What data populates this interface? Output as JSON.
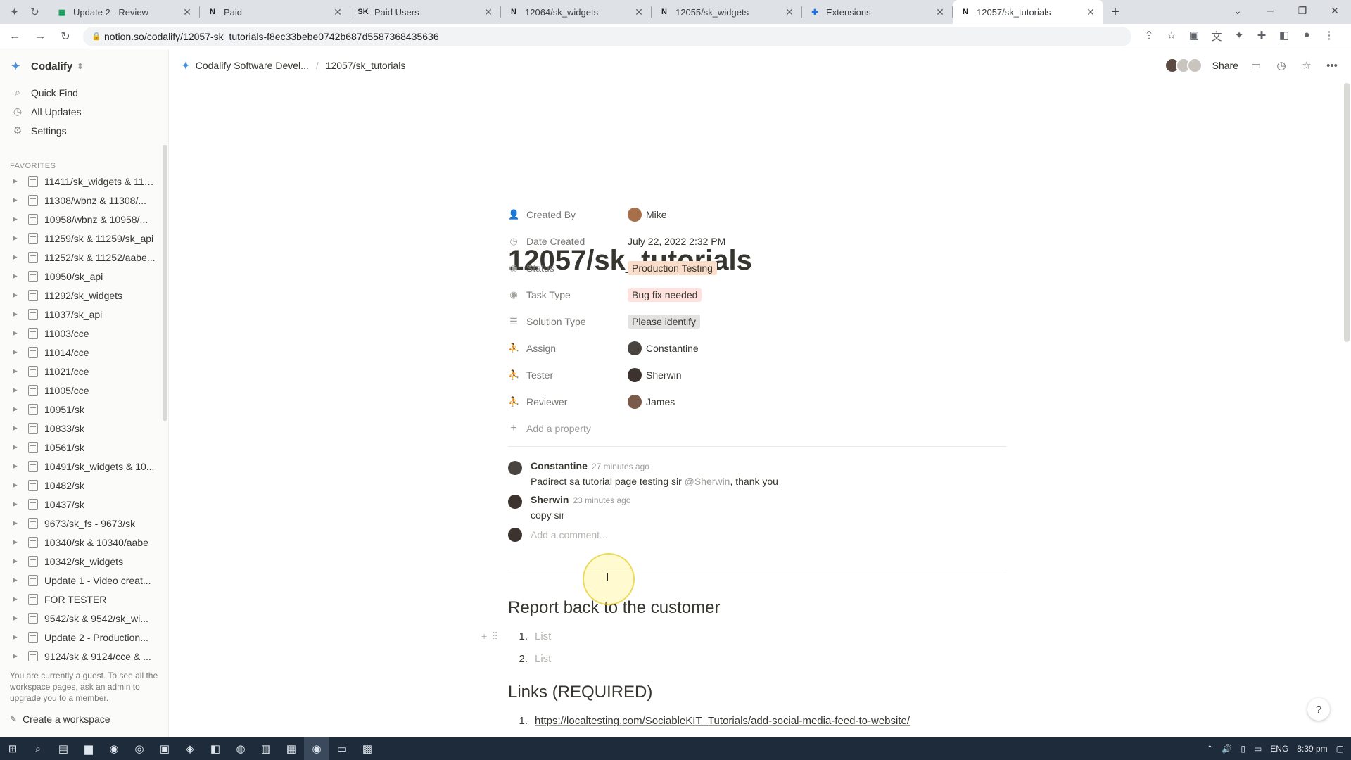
{
  "browser": {
    "tabs": [
      {
        "icon": "sheets-icon",
        "title": "Update 2 - Review"
      },
      {
        "icon": "notion-icon",
        "title": "Paid"
      },
      {
        "icon": "sk-icon",
        "title": "Paid Users"
      },
      {
        "icon": "notion-icon",
        "title": "12064/sk_widgets"
      },
      {
        "icon": "notion-icon",
        "title": "12055/sk_widgets"
      },
      {
        "icon": "puzzle-icon",
        "title": "Extensions"
      },
      {
        "icon": "notion-icon",
        "title": "12057/sk_tutorials"
      }
    ],
    "url": "notion.so/codalify/12057-sk_tutorials-f8ec33bebe0742b687d5587368435636"
  },
  "sidebar": {
    "workspace": "Codalify",
    "nav": [
      {
        "icon": "search-icon",
        "label": "Quick Find"
      },
      {
        "icon": "clock-icon",
        "label": "All Updates"
      },
      {
        "icon": "gear-icon",
        "label": "Settings"
      }
    ],
    "favorites_header": "FAVORITES",
    "favorites": [
      "11411/sk_widgets & 114...",
      "11308/wbnz & 11308/...",
      "10958/wbnz & 10958/...",
      "11259/sk & 11259/sk_api",
      "11252/sk & 11252/aabe...",
      "10950/sk_api",
      "11292/sk_widgets",
      "11037/sk_api",
      "11003/cce",
      "11014/cce",
      "11021/cce",
      "11005/cce",
      "10951/sk",
      "10833/sk",
      "10561/sk",
      "10491/sk_widgets & 10...",
      "10482/sk",
      "10437/sk",
      "9673/sk_fs - 9673/sk",
      "10340/sk & 10340/aabe",
      "10342/sk_widgets",
      "Update 1 - Video creat...",
      "FOR TESTER",
      "9542/sk & 9542/sk_wi...",
      "Update 2 - Production...",
      "9124/sk & 9124/cce & ..."
    ],
    "guest_note": "You are currently a guest. To see all the workspace pages, ask an admin to upgrade you to a member.",
    "create_workspace": "Create a workspace"
  },
  "topbar": {
    "crumb_parent": "Codalify Software Devel...",
    "crumb_sep": "/",
    "crumb_current": "12057/sk_tutorials",
    "share": "Share"
  },
  "page": {
    "title": "12057/sk_tutorials",
    "properties": [
      {
        "label": "Created By",
        "icon": "person-icon",
        "value": "Mike",
        "kind": "person"
      },
      {
        "label": "Date Created",
        "icon": "clock-icon",
        "value": "July 22, 2022 2:32 PM",
        "kind": "text"
      },
      {
        "label": "Status",
        "icon": "select-icon",
        "value": "Production Testing",
        "kind": "chip-prod"
      },
      {
        "label": "Task Type",
        "icon": "select-icon",
        "value": "Bug fix needed",
        "kind": "chip-bug"
      },
      {
        "label": "Solution Type",
        "icon": "list-icon",
        "value": "Please identify",
        "kind": "chip-pi"
      },
      {
        "label": "Assign",
        "icon": "people-icon",
        "value": "Constantine",
        "kind": "person"
      },
      {
        "label": "Tester",
        "icon": "people-icon",
        "value": "Sherwin",
        "kind": "person"
      },
      {
        "label": "Reviewer",
        "icon": "people-icon",
        "value": "James",
        "kind": "person"
      }
    ],
    "add_property": "Add a property",
    "comments": [
      {
        "author": "Constantine",
        "time": "27 minutes ago",
        "text": "Padirect sa tutorial page testing sir",
        "mention": "@Sherwin",
        "tail": ", thank you"
      },
      {
        "author": "Sherwin",
        "time": "23 minutes ago",
        "text": "copy sir",
        "mention": "",
        "tail": ""
      }
    ],
    "add_comment": "Add a comment...",
    "report_heading": "Report back to the customer",
    "report_items": [
      {
        "num": "1.",
        "text": "List"
      },
      {
        "num": "2.",
        "text": "List"
      }
    ],
    "links_heading": "Links (REQUIRED)",
    "links": [
      {
        "num": "1.",
        "text": "https://localtesting.com/SociableKIT_Tutorials/add-social-media-feed-to-website/"
      }
    ],
    "help": "?"
  },
  "taskbar": {
    "lang": "ENG",
    "time": "8:39 pm"
  }
}
